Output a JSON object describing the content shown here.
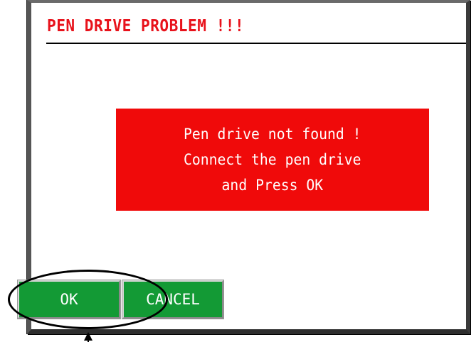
{
  "dialog": {
    "title": "PEN DRIVE PROBLEM !!!",
    "message": {
      "line1": "Pen drive not found !",
      "line2": "Connect the pen drive",
      "line3": "and Press OK"
    },
    "buttons": {
      "ok_label": "OK",
      "cancel_label": "CANCEL"
    }
  },
  "colors": {
    "title": "#e8121b",
    "message_bg": "#f00a0a",
    "button_bg": "#139a35",
    "bezel": "#3a3a3a"
  },
  "annotation": {
    "type": "highlight-ellipse-with-arrow",
    "target": "ok-button"
  }
}
